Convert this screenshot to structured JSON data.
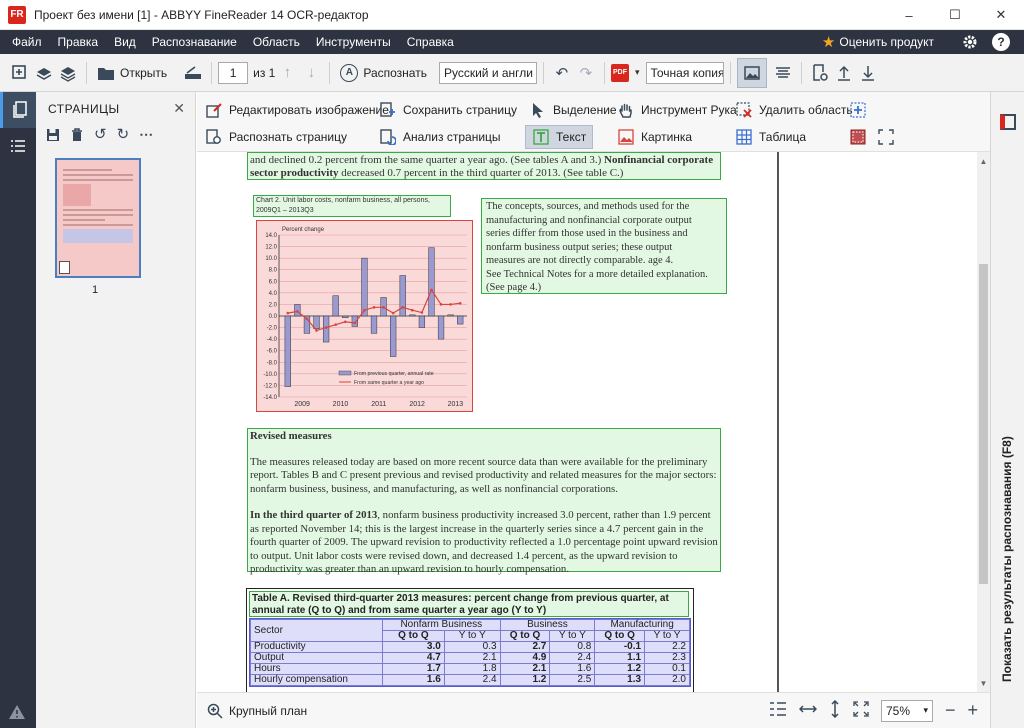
{
  "window": {
    "title": "Проект без имени [1] - ABBYY FineReader 14 OCR-редактор",
    "logo_text": "FR",
    "controls": {
      "minimize": "–",
      "maximize": "☐",
      "close": "✕"
    }
  },
  "menu": {
    "items": [
      "Файл",
      "Правка",
      "Вид",
      "Распознавание",
      "Область",
      "Инструменты",
      "Справка"
    ],
    "rate_label": "Оценить продукт"
  },
  "toolbar": {
    "open_label": "Открыть",
    "page_number": "1",
    "page_of": "из 1",
    "recognize_label": "Распознать",
    "language": "Русский и англи",
    "pdf_badge": "PDF",
    "mode": "Точная копия"
  },
  "pages_panel": {
    "title": "СТРАНИЦЫ",
    "thumb_label": "1"
  },
  "actions": {
    "edit_image": "Редактировать изображение",
    "recognize_page": "Распознать страницу",
    "save_page": "Сохранить страницу",
    "analyze_page": "Анализ страницы",
    "select": "Выделение",
    "hand": "Инструмент Рука",
    "delete_area": "Удалить область",
    "text": "Текст",
    "picture": "Картинка",
    "table": "Таблица"
  },
  "document": {
    "top_para": "and declined 0.2 percent from the same quarter a year ago. (See tables A and 3.)",
    "top_para_bold": "Nonfinancial corporate sector productivity",
    "top_para_end": "decreased 0.7 percent in the third quarter of 2013. (See table C.)",
    "chart_caption_1": "Chart 2. Unit labor costs, nonfarm business, all persons,",
    "chart_caption_2": "2009Q1 – 2013Q3",
    "note_lines": [
      "The concepts, sources, and methods used for the",
      "manufacturing and nonfinancial corporate output",
      "series differ from those used in the business and",
      "nonfarm business output series; these output",
      "measures are not directly comparable. age 4.",
      "See Technical Notes for a more detailed explanation.",
      "(See page 4.)"
    ],
    "revised_heading": "Revised measures",
    "revised_para1": "The measures released today are based on more recent source data than were available for the preliminary report. Tables B and C present previous and revised productivity and related measures for the major sectors: nonfarm business, business, and manufacturing, as well as nonfinancial corporations.",
    "revised_para2_bold": "In the third quarter of 2013",
    "revised_para2": ", nonfarm business productivity increased 3.0 percent, rather than 1.9 percent as reported November 14; this is the largest increase in the quarterly series since a 4.7 percent gain in the fourth quarter of 2009. The upward revision to productivity reflected a 1.0 percentage point upward revision to output. Unit labor costs were revised down, and decreased 1.4 percent, as the upward revision to productivity was greater than an upward revision to hourly compensation.",
    "table_a_title": "Table A. Revised third-quarter 2013 measures: percent change from previous quarter, at annual rate (Q to Q) and from same quarter a year ago (Y to Y)",
    "table_a": {
      "sector_header": "Sector",
      "groups": [
        "Nonfarm Business",
        "Business",
        "Manufacturing"
      ],
      "subheaders": [
        "Q to Q",
        "Y to Y",
        "Q to Q",
        "Y to Y",
        "Q to Q",
        "Y to Y"
      ],
      "rows": [
        {
          "label": "Productivity",
          "values": [
            "3.0",
            "0.3",
            "2.7",
            "0.8",
            "-0.1",
            "2.2"
          ]
        },
        {
          "label": "Output",
          "values": [
            "4.7",
            "2.1",
            "4.9",
            "2.4",
            "1.1",
            "2.3"
          ]
        },
        {
          "label": "Hours",
          "values": [
            "1.7",
            "1.8",
            "2.1",
            "1.6",
            "1.2",
            "0.1"
          ]
        },
        {
          "label": "Hourly compensation",
          "values": [
            "1.6",
            "2.4",
            "1.2",
            "2.5",
            "1.3",
            "2.0"
          ]
        }
      ]
    }
  },
  "chart_data": {
    "type": "bar",
    "ylabel": "Percent change",
    "ylim": [
      -14,
      14
    ],
    "yticks": [
      "14.0",
      "12.0",
      "10.0",
      "8.0",
      "6.0",
      "4.0",
      "2.0",
      "0.0",
      "-2.0",
      "-4.0",
      "-6.0",
      "-8.0",
      "-10.0",
      "-12.0",
      "-14.0"
    ],
    "xticks": [
      "2009",
      "2010",
      "2011",
      "2012",
      "2013"
    ],
    "grid": true,
    "legend_position": "bottom-center",
    "series": [
      {
        "name": "From previous quarter, annual rate",
        "kind": "bar",
        "color": "#9a9ad0",
        "values": [
          -12.2,
          2.0,
          -3.0,
          -2.2,
          -4.5,
          3.5,
          -0.3,
          -1.8,
          10.0,
          -3.0,
          3.2,
          -7.0,
          7.0,
          0.2,
          -2.0,
          11.8,
          -4.0,
          0.2,
          -1.4
        ]
      },
      {
        "name": "From same quarter a year ago",
        "kind": "line",
        "color": "#d9443c",
        "values": [
          0.5,
          0.8,
          -0.5,
          -2.5,
          -2.0,
          -1.5,
          -1.0,
          -1.2,
          1.0,
          1.5,
          1.5,
          0.5,
          1.5,
          1.0,
          0.6,
          4.5,
          2.0,
          2.0,
          2.2
        ]
      }
    ]
  },
  "right_panel": {
    "label": "Показать результаты распознавания (F8)"
  },
  "status": {
    "zoom_label": "Крупный план",
    "zoom_value": "75%",
    "minus": "−",
    "plus": "+"
  },
  "colors": {
    "menubar": "#2d3340",
    "accent_red": "#d9271e",
    "text_block": "#3aa845",
    "picture_block": "#d9443c",
    "table_block": "#5a5ad0"
  }
}
